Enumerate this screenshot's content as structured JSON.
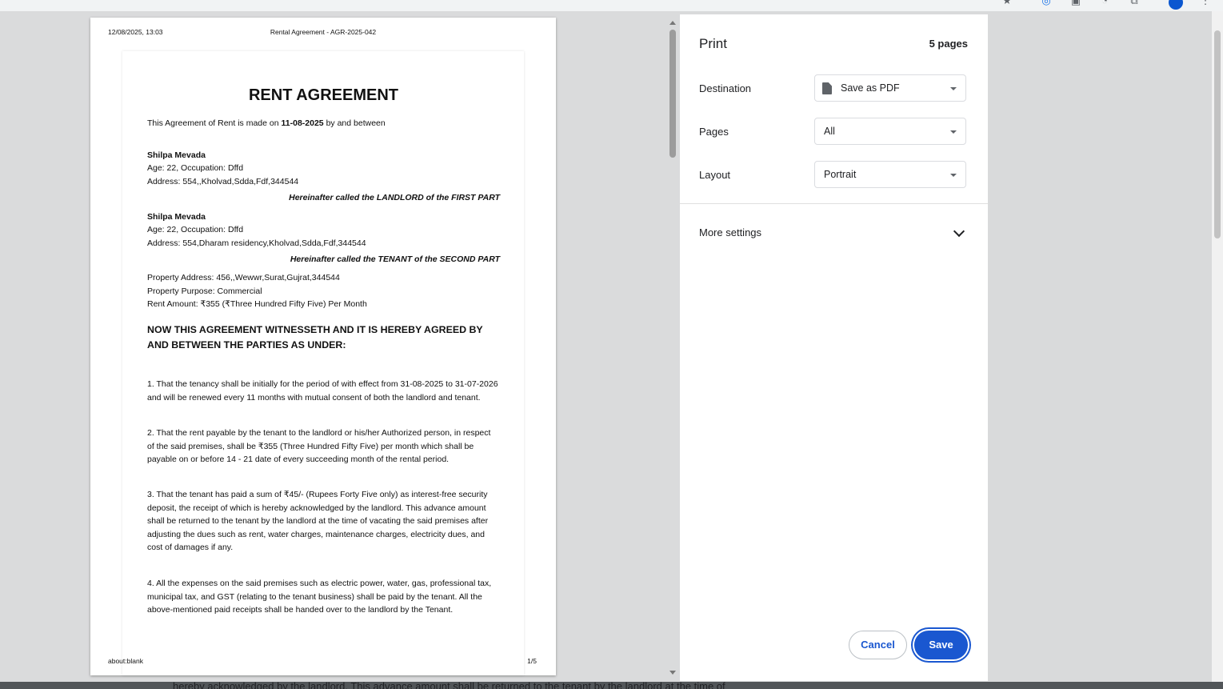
{
  "browser": {
    "toolbar_icons": [
      "star-icon",
      "extension-icon",
      "camera-icon",
      "profile-icon",
      "tab-icon",
      "avatar",
      "menu-icon"
    ]
  },
  "underlying_text": "hereby acknowledged by the landlord. This advance amount shall be returned to the tenant by the landlord at the time of",
  "preview": {
    "header_date": "12/08/2025, 13:03",
    "header_title": "Rental Agreement - AGR-2025-042",
    "footer_url": "about:blank",
    "footer_page": "1/5",
    "document": {
      "title": "RENT AGREEMENT",
      "intro_prefix": "This Agreement of Rent is made on ",
      "intro_date": "11-08-2025",
      "intro_suffix": " by and between",
      "landlord": {
        "name": "Shilpa Mevada",
        "age_occupation": "Age: 22, Occupation: Dffd",
        "address": "Address: 554,,Kholvad,Sdda,Fdf,344544",
        "tag": "Hereinafter called the LANDLORD of the FIRST PART"
      },
      "tenant": {
        "name": "Shilpa Mevada",
        "age_occupation": "Age: 22, Occupation: Dffd",
        "address": "Address: 554,Dharam residency,Kholvad,Sdda,Fdf,344544",
        "tag": "Hereinafter called the TENANT of the SECOND PART"
      },
      "property_address": "Property Address: 456,,Wewwr,Surat,Gujrat,344544",
      "property_purpose": "Property Purpose: Commercial",
      "rent_amount": "Rent Amount: ₹355 (₹Three Hundred Fifty Five) Per Month",
      "witness_heading": "NOW THIS AGREEMENT WITNESSETH AND IT IS HEREBY AGREED BY AND BETWEEN THE PARTIES AS UNDER:",
      "clauses": [
        "1. That the tenancy shall be initially for the period of with effect from 31-08-2025 to 31-07-2026 and will be renewed every 11 months with mutual consent of both the landlord and tenant.",
        "2. That the rent payable by the tenant to the landlord or his/her Authorized person, in respect of the said premises, shall be ₹355 (Three Hundred Fifty Five) per month which shall be payable on or before 14 - 21 date of every succeeding month of the rental period.",
        "3. That the tenant has paid a sum of ₹45/- (Rupees Forty Five only) as interest-free security deposit, the receipt of which is hereby acknowledged by the landlord. This advance amount shall be returned to the tenant by the landlord at the time of vacating the said premises after adjusting the dues such as rent, water charges, maintenance charges, electricity dues, and cost of damages if any.",
        "4. All the expenses on the said premises such as electric power, water, gas, professional tax, municipal tax, and GST (relating to the tenant business) shall be paid by the tenant. All the above-mentioned paid receipts shall be handed over to the landlord by the Tenant."
      ]
    }
  },
  "print_panel": {
    "title": "Print",
    "page_count": "5 pages",
    "destination_label": "Destination",
    "destination_value": "Save as PDF",
    "pages_label": "Pages",
    "pages_value": "All",
    "layout_label": "Layout",
    "layout_value": "Portrait",
    "more_settings": "More settings",
    "cancel_label": "Cancel",
    "save_label": "Save",
    "accent_color": "#1a57d0"
  }
}
